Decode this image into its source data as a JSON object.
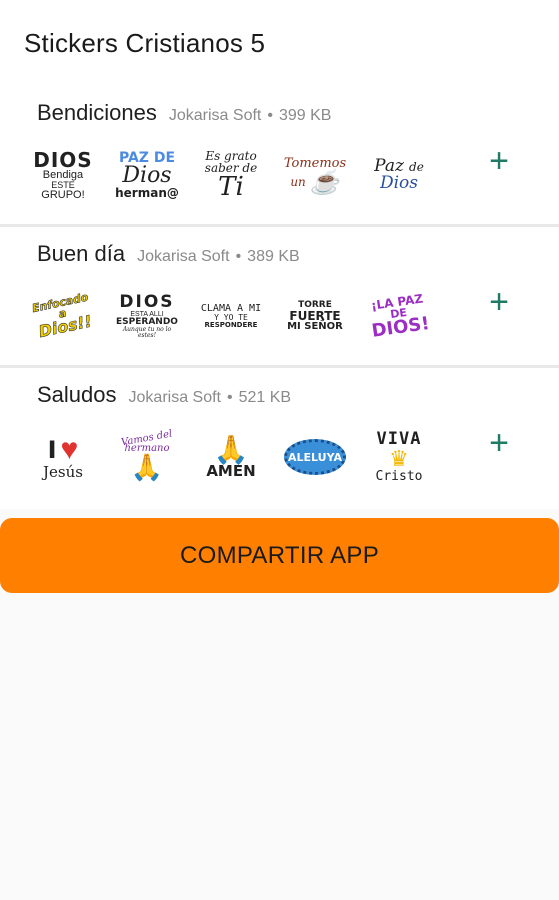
{
  "app": {
    "title": "Stickers Cristianos 5"
  },
  "packs": [
    {
      "name": "Bendiciones",
      "author": "Jokarisa Soft",
      "size": "399 KB",
      "stickers": [
        {
          "lines": [
            "DIOS",
            "Bendiga",
            "este",
            "grupo!"
          ],
          "icon": "dios-bendiga-sticker"
        },
        {
          "lines": [
            "PAZ DE",
            "Dios",
            "herman@"
          ],
          "icon": "paz-de-dios-hermano-sticker"
        },
        {
          "lines": [
            "Es grato",
            "saber de",
            "Ti"
          ],
          "icon": "es-grato-saber-de-ti-sticker"
        },
        {
          "lines": [
            "Tomemos",
            "un"
          ],
          "icon": "tomemos-un-cafe-sticker"
        },
        {
          "lines": [
            "Paz",
            "de",
            "Dios"
          ],
          "icon": "paz-de-dios-sticker"
        }
      ]
    },
    {
      "name": "Buen día",
      "author": "Jokarisa Soft",
      "size": "389 KB",
      "stickers": [
        {
          "lines": [
            "Enfocado a",
            "Dios!!"
          ],
          "icon": "enfocado-a-dios-sticker"
        },
        {
          "lines": [
            "DIOS",
            "ESTA ALLI",
            "ESPERANDO",
            "Aunque tu no lo estes!"
          ],
          "icon": "dios-esta-alli-esperando-sticker"
        },
        {
          "lines": [
            "CLAMA A MI",
            "Y YO TE",
            "RESPONDERE"
          ],
          "icon": "clama-a-mi-sticker"
        },
        {
          "lines": [
            "TORRE",
            "FUERTE",
            "MI SEÑOR"
          ],
          "icon": "torre-fuerte-sticker"
        },
        {
          "lines": [
            "¡LA PAZ",
            "DE",
            "DIOS!"
          ],
          "icon": "la-paz-de-dios-sticker"
        }
      ]
    },
    {
      "name": "Saludos",
      "author": "Jokarisa Soft",
      "size": "521 KB",
      "stickers": [
        {
          "lines": [
            "I",
            "Jesús"
          ],
          "icon": "i-love-jesus-sticker"
        },
        {
          "lines": [
            "Vamos del",
            "hermano"
          ],
          "icon": "praying-hands-sticker"
        },
        {
          "lines": [
            "AMEN"
          ],
          "icon": "amen-hands-sticker"
        },
        {
          "lines": [
            "ALELUYA"
          ],
          "icon": "aleluya-burst-sticker"
        },
        {
          "lines": [
            "VIVA",
            "Cristo"
          ],
          "icon": "viva-cristo-crown-sticker"
        }
      ]
    }
  ],
  "share_button": {
    "label": "COMPARTIR APP"
  },
  "colors": {
    "accent": "#ff8000",
    "add_icon": "#1f7a66"
  }
}
